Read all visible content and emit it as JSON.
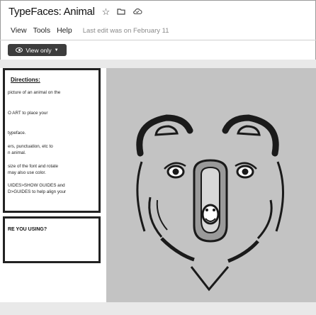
{
  "document": {
    "title": "TypeFaces: Animal",
    "title_icons": [
      "star-icon",
      "folder-icon",
      "cloud-icon"
    ]
  },
  "menu": {
    "items": [
      "View",
      "Tools",
      "Help"
    ],
    "last_edit": "Last edit was on February 11"
  },
  "toolbar": {
    "view_only_label": "View only",
    "view_only_icon": "eye-icon",
    "dropdown_icon": "caret-down-icon"
  },
  "slide": {
    "directions_heading": "Directions:",
    "directions_lines": [
      "picture of an animal on the",
      "O ART to place your",
      "typeface.",
      "ers, punctuation, etc to",
      "n animal.",
      "size of the font and rotate",
      "may also use color.",
      "UIDES>SHOW GUIDES and",
      "D>GUIDES to help align your"
    ],
    "question": "RE YOU USING?"
  },
  "colors": {
    "bear_stroke": "#1a1a1a",
    "slide_background": "#c3c3c3",
    "view_only_background": "#3d3d3d"
  }
}
